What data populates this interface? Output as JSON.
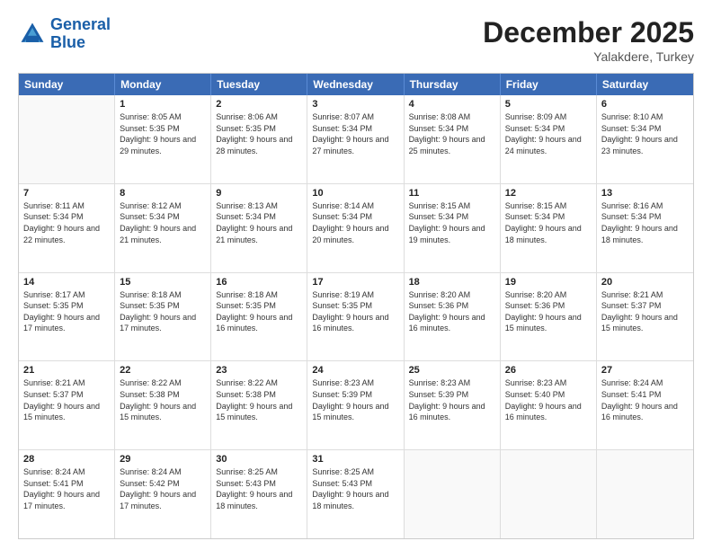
{
  "logo": {
    "line1": "General",
    "line2": "Blue"
  },
  "title": "December 2025",
  "subtitle": "Yalakdere, Turkey",
  "header_days": [
    "Sunday",
    "Monday",
    "Tuesday",
    "Wednesday",
    "Thursday",
    "Friday",
    "Saturday"
  ],
  "weeks": [
    [
      {
        "day": "",
        "sunrise": "",
        "sunset": "",
        "daylight": ""
      },
      {
        "day": "1",
        "sunrise": "Sunrise: 8:05 AM",
        "sunset": "Sunset: 5:35 PM",
        "daylight": "Daylight: 9 hours and 29 minutes."
      },
      {
        "day": "2",
        "sunrise": "Sunrise: 8:06 AM",
        "sunset": "Sunset: 5:35 PM",
        "daylight": "Daylight: 9 hours and 28 minutes."
      },
      {
        "day": "3",
        "sunrise": "Sunrise: 8:07 AM",
        "sunset": "Sunset: 5:34 PM",
        "daylight": "Daylight: 9 hours and 27 minutes."
      },
      {
        "day": "4",
        "sunrise": "Sunrise: 8:08 AM",
        "sunset": "Sunset: 5:34 PM",
        "daylight": "Daylight: 9 hours and 25 minutes."
      },
      {
        "day": "5",
        "sunrise": "Sunrise: 8:09 AM",
        "sunset": "Sunset: 5:34 PM",
        "daylight": "Daylight: 9 hours and 24 minutes."
      },
      {
        "day": "6",
        "sunrise": "Sunrise: 8:10 AM",
        "sunset": "Sunset: 5:34 PM",
        "daylight": "Daylight: 9 hours and 23 minutes."
      }
    ],
    [
      {
        "day": "7",
        "sunrise": "Sunrise: 8:11 AM",
        "sunset": "Sunset: 5:34 PM",
        "daylight": "Daylight: 9 hours and 22 minutes."
      },
      {
        "day": "8",
        "sunrise": "Sunrise: 8:12 AM",
        "sunset": "Sunset: 5:34 PM",
        "daylight": "Daylight: 9 hours and 21 minutes."
      },
      {
        "day": "9",
        "sunrise": "Sunrise: 8:13 AM",
        "sunset": "Sunset: 5:34 PM",
        "daylight": "Daylight: 9 hours and 21 minutes."
      },
      {
        "day": "10",
        "sunrise": "Sunrise: 8:14 AM",
        "sunset": "Sunset: 5:34 PM",
        "daylight": "Daylight: 9 hours and 20 minutes."
      },
      {
        "day": "11",
        "sunrise": "Sunrise: 8:15 AM",
        "sunset": "Sunset: 5:34 PM",
        "daylight": "Daylight: 9 hours and 19 minutes."
      },
      {
        "day": "12",
        "sunrise": "Sunrise: 8:15 AM",
        "sunset": "Sunset: 5:34 PM",
        "daylight": "Daylight: 9 hours and 18 minutes."
      },
      {
        "day": "13",
        "sunrise": "Sunrise: 8:16 AM",
        "sunset": "Sunset: 5:34 PM",
        "daylight": "Daylight: 9 hours and 18 minutes."
      }
    ],
    [
      {
        "day": "14",
        "sunrise": "Sunrise: 8:17 AM",
        "sunset": "Sunset: 5:35 PM",
        "daylight": "Daylight: 9 hours and 17 minutes."
      },
      {
        "day": "15",
        "sunrise": "Sunrise: 8:18 AM",
        "sunset": "Sunset: 5:35 PM",
        "daylight": "Daylight: 9 hours and 17 minutes."
      },
      {
        "day": "16",
        "sunrise": "Sunrise: 8:18 AM",
        "sunset": "Sunset: 5:35 PM",
        "daylight": "Daylight: 9 hours and 16 minutes."
      },
      {
        "day": "17",
        "sunrise": "Sunrise: 8:19 AM",
        "sunset": "Sunset: 5:35 PM",
        "daylight": "Daylight: 9 hours and 16 minutes."
      },
      {
        "day": "18",
        "sunrise": "Sunrise: 8:20 AM",
        "sunset": "Sunset: 5:36 PM",
        "daylight": "Daylight: 9 hours and 16 minutes."
      },
      {
        "day": "19",
        "sunrise": "Sunrise: 8:20 AM",
        "sunset": "Sunset: 5:36 PM",
        "daylight": "Daylight: 9 hours and 15 minutes."
      },
      {
        "day": "20",
        "sunrise": "Sunrise: 8:21 AM",
        "sunset": "Sunset: 5:37 PM",
        "daylight": "Daylight: 9 hours and 15 minutes."
      }
    ],
    [
      {
        "day": "21",
        "sunrise": "Sunrise: 8:21 AM",
        "sunset": "Sunset: 5:37 PM",
        "daylight": "Daylight: 9 hours and 15 minutes."
      },
      {
        "day": "22",
        "sunrise": "Sunrise: 8:22 AM",
        "sunset": "Sunset: 5:38 PM",
        "daylight": "Daylight: 9 hours and 15 minutes."
      },
      {
        "day": "23",
        "sunrise": "Sunrise: 8:22 AM",
        "sunset": "Sunset: 5:38 PM",
        "daylight": "Daylight: 9 hours and 15 minutes."
      },
      {
        "day": "24",
        "sunrise": "Sunrise: 8:23 AM",
        "sunset": "Sunset: 5:39 PM",
        "daylight": "Daylight: 9 hours and 15 minutes."
      },
      {
        "day": "25",
        "sunrise": "Sunrise: 8:23 AM",
        "sunset": "Sunset: 5:39 PM",
        "daylight": "Daylight: 9 hours and 16 minutes."
      },
      {
        "day": "26",
        "sunrise": "Sunrise: 8:23 AM",
        "sunset": "Sunset: 5:40 PM",
        "daylight": "Daylight: 9 hours and 16 minutes."
      },
      {
        "day": "27",
        "sunrise": "Sunrise: 8:24 AM",
        "sunset": "Sunset: 5:41 PM",
        "daylight": "Daylight: 9 hours and 16 minutes."
      }
    ],
    [
      {
        "day": "28",
        "sunrise": "Sunrise: 8:24 AM",
        "sunset": "Sunset: 5:41 PM",
        "daylight": "Daylight: 9 hours and 17 minutes."
      },
      {
        "day": "29",
        "sunrise": "Sunrise: 8:24 AM",
        "sunset": "Sunset: 5:42 PM",
        "daylight": "Daylight: 9 hours and 17 minutes."
      },
      {
        "day": "30",
        "sunrise": "Sunrise: 8:25 AM",
        "sunset": "Sunset: 5:43 PM",
        "daylight": "Daylight: 9 hours and 18 minutes."
      },
      {
        "day": "31",
        "sunrise": "Sunrise: 8:25 AM",
        "sunset": "Sunset: 5:43 PM",
        "daylight": "Daylight: 9 hours and 18 minutes."
      },
      {
        "day": "",
        "sunrise": "",
        "sunset": "",
        "daylight": ""
      },
      {
        "day": "",
        "sunrise": "",
        "sunset": "",
        "daylight": ""
      },
      {
        "day": "",
        "sunrise": "",
        "sunset": "",
        "daylight": ""
      }
    ]
  ]
}
